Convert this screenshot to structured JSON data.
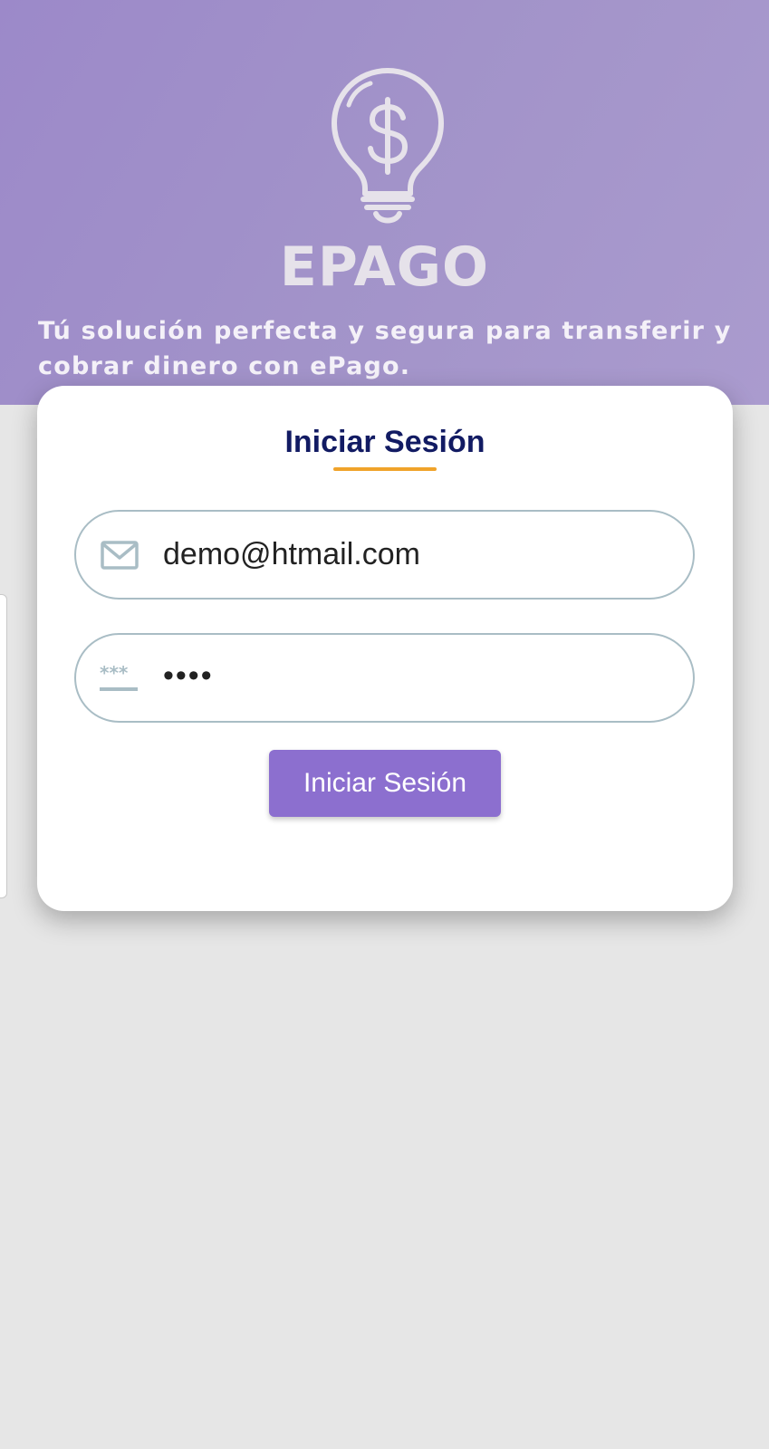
{
  "brand": {
    "logo_icon": "lightbulb-dollar-icon",
    "name": "EPAGO",
    "tagline": "Tú solución perfecta y segura para transferir y cobrar dinero con ePago."
  },
  "login_card": {
    "title": "Iniciar Sesión",
    "email_field": {
      "icon": "envelope-icon",
      "value": "demo@htmail.com"
    },
    "password_field": {
      "icon": "password-asterisks-icon",
      "value": "••••"
    },
    "submit_label": "Iniciar Sesión"
  },
  "colors": {
    "hero_background": "#a293c9",
    "title": "#121b63",
    "title_underline": "#f0a32a",
    "field_border": "#a9bdc5",
    "button_background": "#8c6fcf",
    "page_background": "#e6e6e6"
  }
}
